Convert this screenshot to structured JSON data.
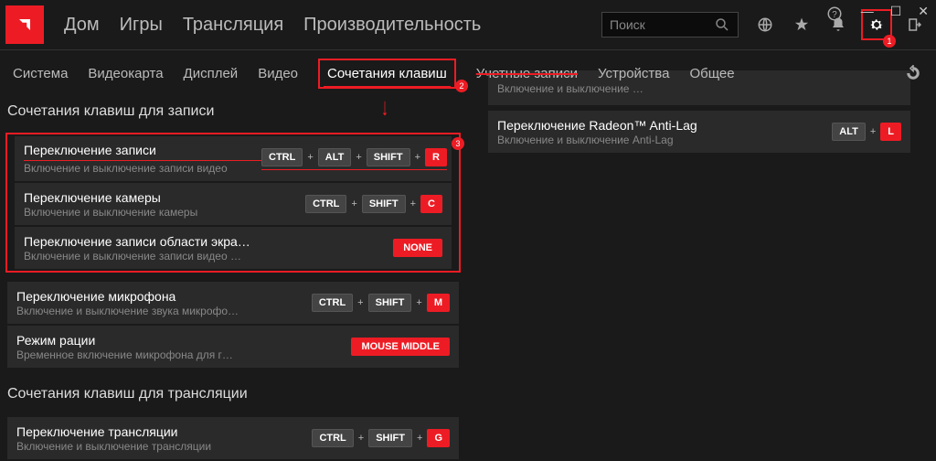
{
  "titlebar": {
    "tabs": [
      "Дом",
      "Игры",
      "Трансляция",
      "Производительность"
    ],
    "search_placeholder": "Поиск"
  },
  "subnav": {
    "items": [
      "Система",
      "Видеокарта",
      "Дисплей",
      "Видео",
      "Сочетания клавиш",
      "Учетные записи",
      "Устройства",
      "Общее"
    ],
    "active_index": 4,
    "strike_index": 5
  },
  "badges": {
    "one": "1",
    "two": "2",
    "three": "3"
  },
  "section1_title": "Сочетания клавиш для записи",
  "cards_group": [
    {
      "title": "Переключение записи",
      "sub": "Включение и выключение записи видео",
      "keys": [
        {
          "k": "CTRL"
        },
        {
          "k": "ALT"
        },
        {
          "k": "SHIFT"
        },
        {
          "k": "R",
          "red": true
        }
      ],
      "underline": true
    },
    {
      "title": "Переключение камеры",
      "sub": "Включение и выключение камеры",
      "keys": [
        {
          "k": "CTRL"
        },
        {
          "k": "SHIFT"
        },
        {
          "k": "C",
          "red": true
        }
      ]
    },
    {
      "title": "Переключение записи области экра…",
      "sub": "Включение и выключение записи видео …",
      "keys": [
        {
          "k": "NONE",
          "red": true,
          "wide": true
        }
      ]
    }
  ],
  "cards_after": [
    {
      "title": "Переключение микрофона",
      "sub": "Включение и выключение звука микрофо…",
      "keys": [
        {
          "k": "CTRL"
        },
        {
          "k": "SHIFT"
        },
        {
          "k": "M",
          "red": true
        }
      ]
    },
    {
      "title": "Режим рации",
      "sub": "Временное включение микрофона для г…",
      "keys": [
        {
          "k": "MOUSE MIDDLE",
          "red": true,
          "wide": true
        }
      ]
    }
  ],
  "section2_title": "Сочетания клавиш для трансляции",
  "cards_section2": [
    {
      "title": "Переключение трансляции",
      "sub": "Включение и выключение трансляции",
      "keys": [
        {
          "k": "CTRL"
        },
        {
          "k": "SHIFT"
        },
        {
          "k": "G",
          "red": true
        }
      ]
    }
  ],
  "right_cards": [
    {
      "title": "",
      "sub": "Включение и выключение …",
      "keys": [],
      "slim": true
    },
    {
      "title": "Переключение Radeon™ Anti-Lag",
      "sub": "Включение и выключение Anti-Lag",
      "keys": [
        {
          "k": "ALT"
        },
        {
          "k": "L",
          "red": true
        }
      ]
    }
  ]
}
